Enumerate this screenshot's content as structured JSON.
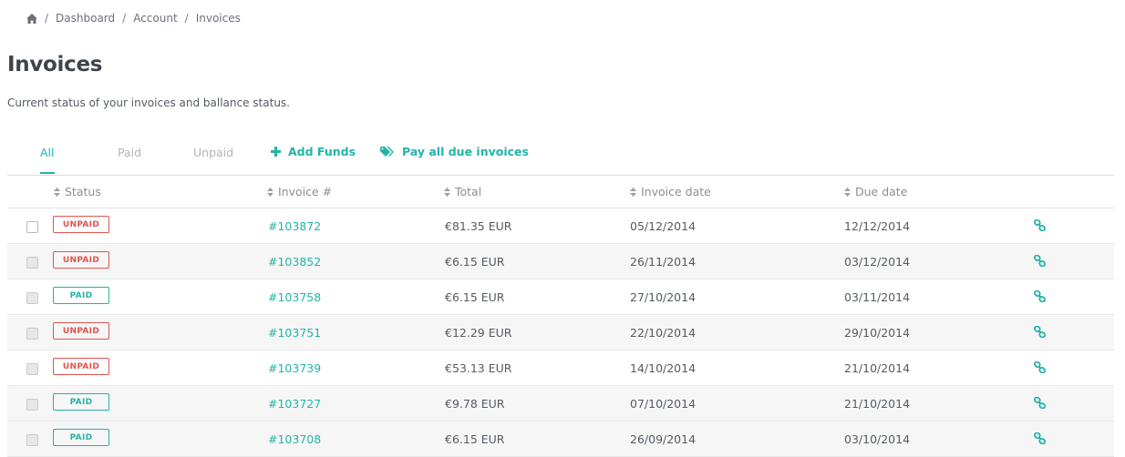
{
  "breadcrumb": {
    "home_icon": "home-icon",
    "separator": "/",
    "items": [
      "Dashboard",
      "Account",
      "Invoices"
    ]
  },
  "page": {
    "title": "Invoices",
    "subtitle": "Current status of your invoices and ballance status."
  },
  "tabs": [
    {
      "label": "All",
      "active": true
    },
    {
      "label": "Paid",
      "active": false
    },
    {
      "label": "Unpaid",
      "active": false
    }
  ],
  "actions": {
    "add_funds": {
      "label": "Add Funds",
      "icon": "plus-icon"
    },
    "pay_all": {
      "label": "Pay all due invoices",
      "icon": "tags-icon"
    }
  },
  "table": {
    "headers": {
      "status": "Status",
      "invoice": "Invoice #",
      "total": "Total",
      "invoice_date": "Invoice date",
      "due_date": "Due date"
    },
    "rows": [
      {
        "status": "UNPAID",
        "invoice": "#103872",
        "total": "€81.35 EUR",
        "invoice_date": "05/12/2014",
        "due_date": "12/12/2014"
      },
      {
        "status": "UNPAID",
        "invoice": "#103852",
        "total": "€6.15 EUR",
        "invoice_date": "26/11/2014",
        "due_date": "03/12/2014"
      },
      {
        "status": "PAID",
        "invoice": "#103758",
        "total": "€6.15 EUR",
        "invoice_date": "27/10/2014",
        "due_date": "03/11/2014"
      },
      {
        "status": "UNPAID",
        "invoice": "#103751",
        "total": "€12.29 EUR",
        "invoice_date": "22/10/2014",
        "due_date": "29/10/2014"
      },
      {
        "status": "UNPAID",
        "invoice": "#103739",
        "total": "€53.13 EUR",
        "invoice_date": "14/10/2014",
        "due_date": "21/10/2014"
      },
      {
        "status": "PAID",
        "invoice": "#103727",
        "total": "€9.78 EUR",
        "invoice_date": "07/10/2014",
        "due_date": "21/10/2014"
      },
      {
        "status": "PAID",
        "invoice": "#103708",
        "total": "€6.15 EUR",
        "invoice_date": "26/09/2014",
        "due_date": "03/10/2014"
      }
    ]
  },
  "colors": {
    "accent": "#23b3a8",
    "unpaid": "#e0534e",
    "paid": "#23b3a8",
    "row_alt": "#f6f6f6"
  }
}
